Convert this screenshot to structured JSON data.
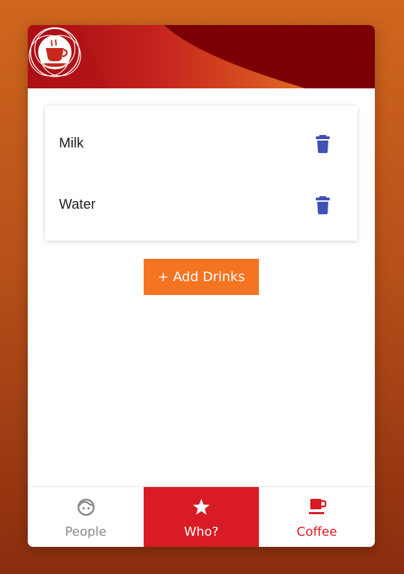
{
  "drinks": [
    {
      "name": "Milk"
    },
    {
      "name": "Water"
    }
  ],
  "actions": {
    "add_drinks_label": "+ Add Drinks"
  },
  "nav": {
    "people_label": "People",
    "who_label": "Who?",
    "coffee_label": "Coffee",
    "active": "Who?"
  },
  "icons": {
    "logo": "coffee-cup-logo",
    "delete": "trash-icon",
    "people": "face-icon",
    "who": "star-icon",
    "coffee": "coffee-mug-icon"
  },
  "colors": {
    "accent_orange": "#f47421",
    "nav_active_red": "#d81b24",
    "trash_blue": "#3f51b5",
    "header_dark_red": "#7a0006"
  }
}
